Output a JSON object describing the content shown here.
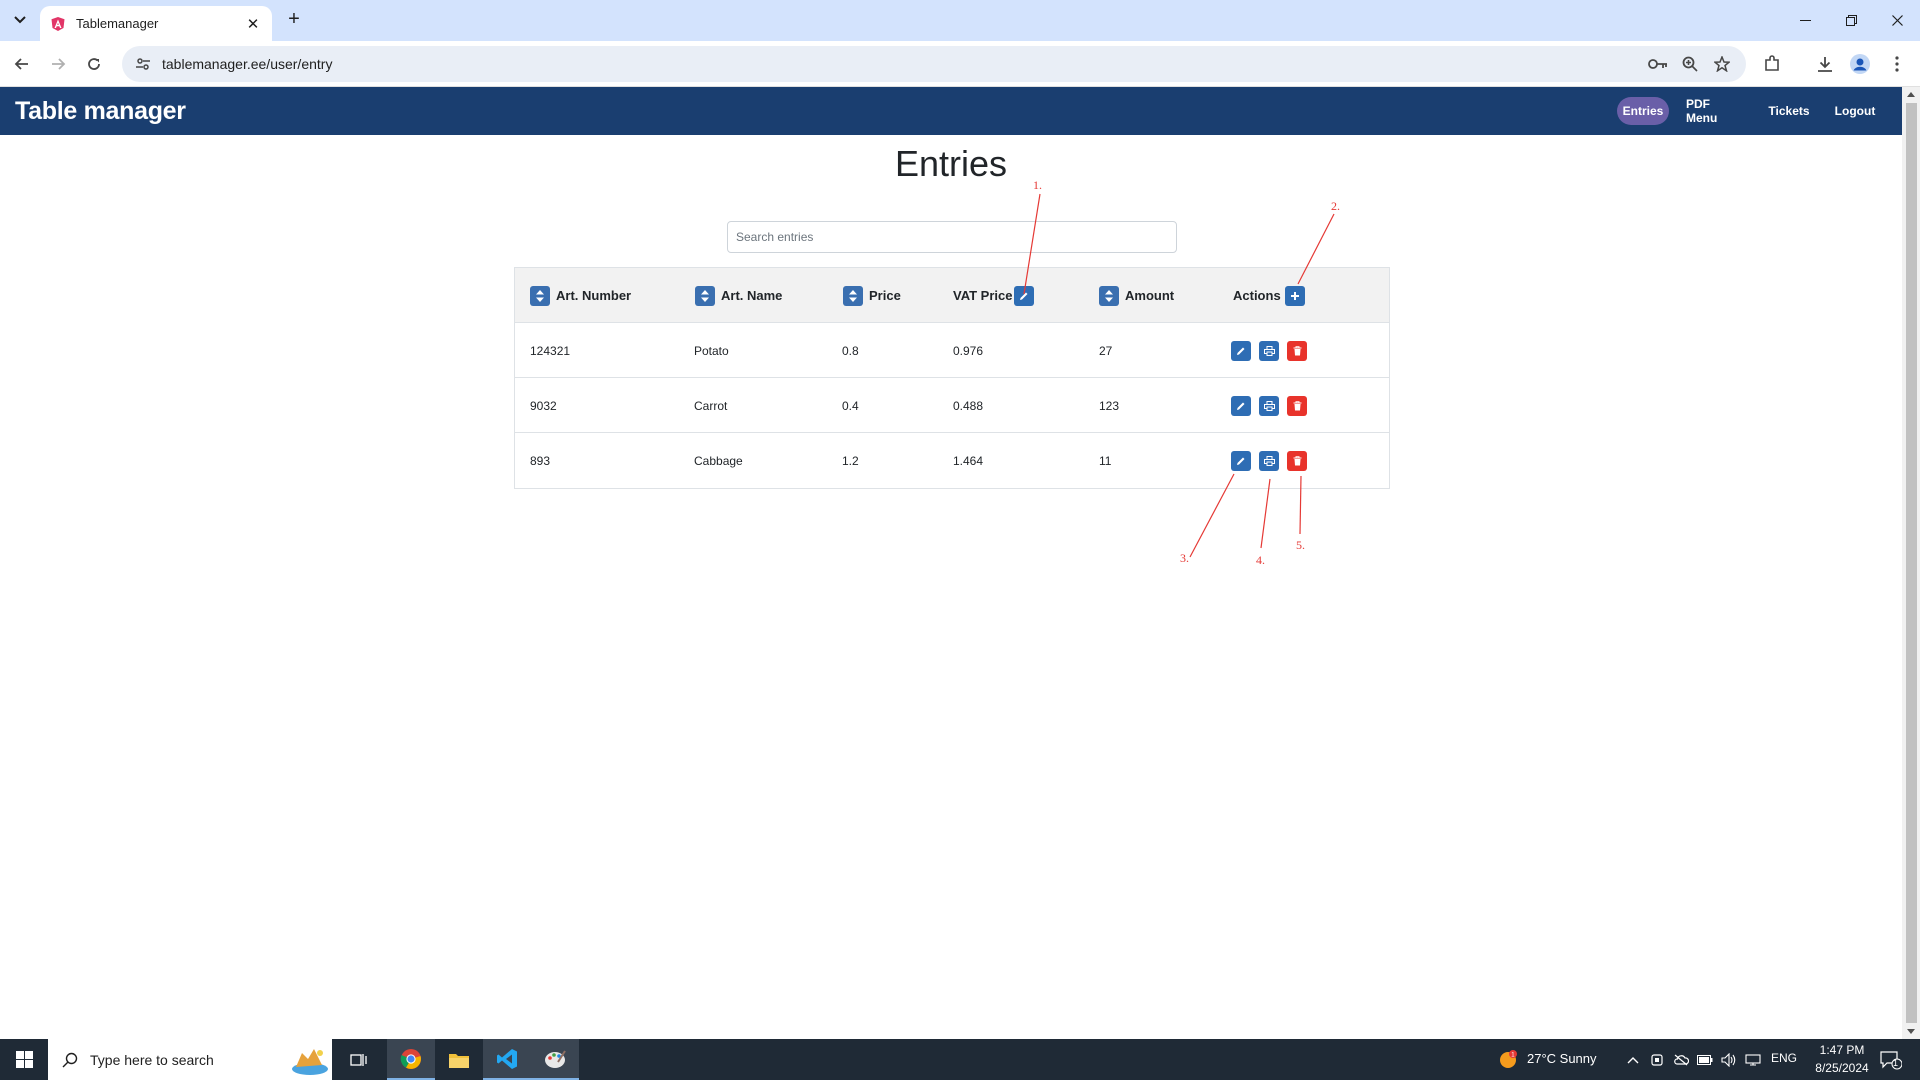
{
  "browser": {
    "tab_title": "Tablemanager",
    "url": "tablemanager.ee/user/entry"
  },
  "app": {
    "brand": "Table manager",
    "nav": [
      {
        "label": "Entries",
        "active": true
      },
      {
        "label": "PDF Menu",
        "active": false
      },
      {
        "label": "Tickets",
        "active": false
      },
      {
        "label": "Logout",
        "active": false
      }
    ]
  },
  "page": {
    "title": "Entries",
    "search_placeholder": "Search entries"
  },
  "table": {
    "headers": {
      "art_number": "Art. Number",
      "art_name": "Art. Name",
      "price": "Price",
      "vat_price": "VAT Price",
      "amount": "Amount",
      "actions": "Actions"
    },
    "rows": [
      {
        "art_number": "124321",
        "art_name": "Potato",
        "price": "0.8",
        "vat_price": "0.976",
        "amount": "27"
      },
      {
        "art_number": "9032",
        "art_name": "Carrot",
        "price": "0.4",
        "vat_price": "0.488",
        "amount": "123"
      },
      {
        "art_number": "893",
        "art_name": "Cabbage",
        "price": "1.2",
        "vat_price": "1.464",
        "amount": "11"
      }
    ]
  },
  "annotations": {
    "a1": "1.",
    "a2": "2.",
    "a3": "3.",
    "a4": "4.",
    "a5": "5."
  },
  "taskbar": {
    "search_placeholder": "Type here to search",
    "weather": "27°C  Sunny",
    "lang": "ENG",
    "time": "1:47 PM",
    "date": "8/25/2024",
    "notification_count": "1"
  },
  "colors": {
    "navbar": "#1a3e70",
    "active_nav": "#6a5fa8",
    "button_blue": "#2e6db4",
    "button_red": "#e8332b",
    "annotation": "#e53935"
  }
}
